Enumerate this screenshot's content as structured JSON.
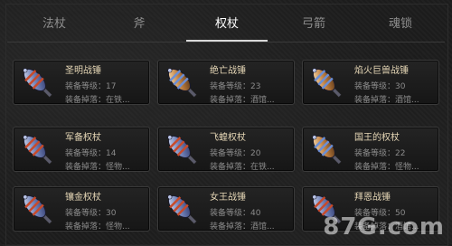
{
  "tabs": [
    {
      "label": "法杖",
      "active": false
    },
    {
      "label": "斧",
      "active": false
    },
    {
      "label": "权杖",
      "active": true
    },
    {
      "label": "弓箭",
      "active": false
    },
    {
      "label": "魂锁",
      "active": false
    }
  ],
  "items": [
    {
      "name": "圣明战锤",
      "level": "装备等级：17",
      "drop": "装备掉落：在铁..."
    },
    {
      "name": "绝亡战锤",
      "level": "装备等级：23",
      "drop": "装备掉落：酒馆..."
    },
    {
      "name": "焰火巨兽战锤",
      "level": "装备等级：30",
      "drop": "装备掉落：酒馆..."
    },
    {
      "name": "军备权杖",
      "level": "装备等级：14",
      "drop": "装备掉落：怪物..."
    },
    {
      "name": "飞蝗权杖",
      "level": "装备等级：20",
      "drop": "装备掉落：在铁..."
    },
    {
      "name": "国王的权杖",
      "level": "装备等级：22",
      "drop": "装备掉落：怪物..."
    },
    {
      "name": "镶金权杖",
      "level": "装备等级：30",
      "drop": "装备掉落：怪物..."
    },
    {
      "name": "女王战锤",
      "level": "装备等级：40",
      "drop": "装备掉落：酒馆..."
    },
    {
      "name": "拜恩战锤",
      "level": "装备等级：50",
      "drop": "装备掉落：酒馆..."
    }
  ],
  "watermark": "87G.com"
}
